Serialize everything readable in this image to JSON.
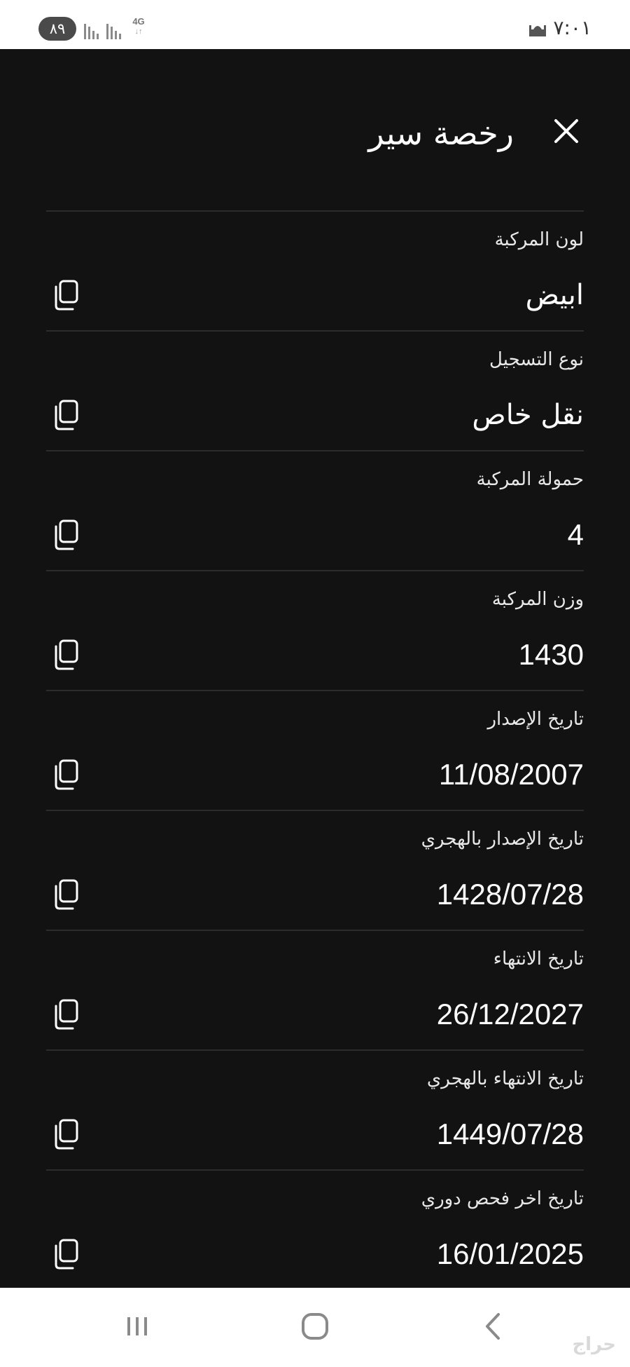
{
  "status_bar": {
    "battery": "٨٩",
    "network": "4G",
    "time": "٧:٠١",
    "icons": [
      "signal-icon",
      "signal-icon",
      "network-4g-icon",
      "mosque-icon"
    ]
  },
  "header": {
    "title": "رخصة سير",
    "close_icon": "close-icon"
  },
  "fields": [
    {
      "label": "لون المركبة",
      "value": "ابيض"
    },
    {
      "label": "نوع التسجيل",
      "value": "نقل خاص"
    },
    {
      "label": "حمولة المركبة",
      "value": "4"
    },
    {
      "label": "وزن المركبة",
      "value": "1430"
    },
    {
      "label": "تاريخ الإصدار",
      "value": "11/08/2007"
    },
    {
      "label": "تاريخ الإصدار بالهجري",
      "value": "1428/07/28"
    },
    {
      "label": "تاريخ الانتهاء",
      "value": "26/12/2027"
    },
    {
      "label": "تاريخ الانتهاء بالهجري",
      "value": "1449/07/28"
    },
    {
      "label": "تاريخ اخر فحص دوري",
      "value": "16/01/2025"
    }
  ],
  "nav_bar": {
    "icons": [
      "recent-apps-icon",
      "home-icon",
      "back-icon"
    ],
    "watermark": "حراج"
  },
  "colors": {
    "background": "#121212",
    "divider": "#2c2c2c",
    "text": "#ffffff",
    "label": "#e8e8e8"
  }
}
